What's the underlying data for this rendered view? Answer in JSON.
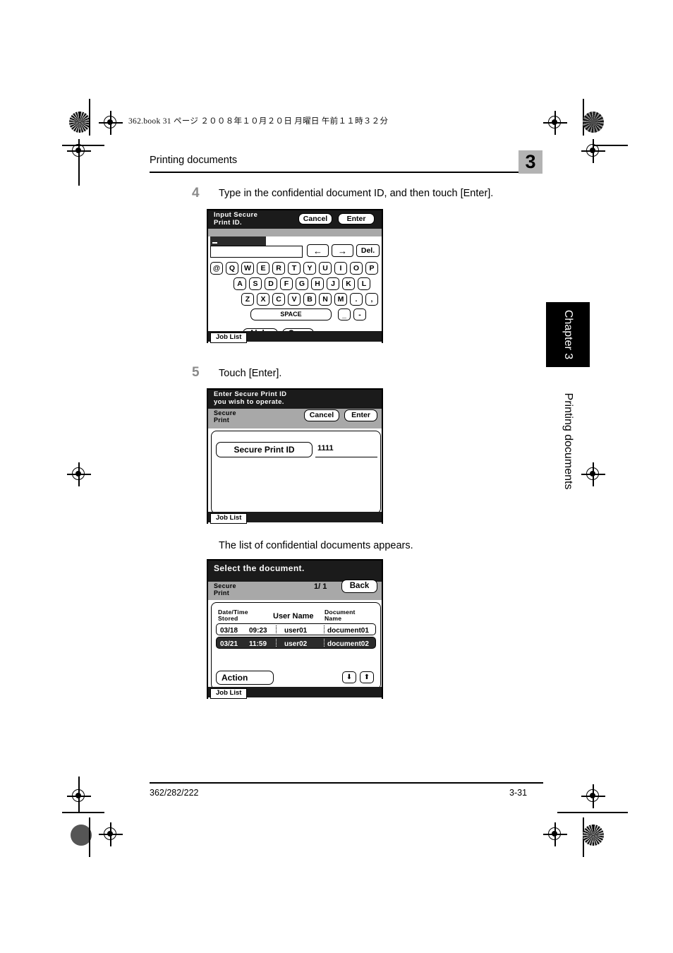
{
  "page": {
    "book_info": "362.book  31 ページ  ２００８年１０月２０日  月曜日  午前１１時３２分",
    "running_head": "Printing documents",
    "chapter_number": "3",
    "side_tab_label": "Chapter 3",
    "side_vertical_label": "Printing documents",
    "footer_left": "362/282/222",
    "footer_right": "3-31"
  },
  "steps": [
    {
      "number": "4",
      "text": "Type in the confidential document ID, and then touch [Enter]."
    },
    {
      "number": "5",
      "text": "Touch [Enter]."
    }
  ],
  "caption": "The list of confidential documents appears.",
  "panel1": {
    "title": "Input Secure\nPrint ID.",
    "title_line1": "Input Secure",
    "title_line2": "Print ID.",
    "cancel_label": "Cancel",
    "enter_label": "Enter",
    "left_arrow": "←",
    "right_arrow": "→",
    "del_label": "Del.",
    "keys_row1": [
      "@",
      "Q",
      "W",
      "E",
      "R",
      "T",
      "Y",
      "U",
      "I",
      "O",
      "P"
    ],
    "keys_row2": [
      "A",
      "S",
      "D",
      "F",
      "G",
      "H",
      "J",
      "K",
      "L"
    ],
    "keys_row3": [
      "Z",
      "X",
      "C",
      "V",
      "B",
      "N",
      "M",
      ".",
      ","
    ],
    "space_label": "SPACE",
    "underscore_label": "_",
    "hyphen_label": "-",
    "alpha_label": "Alpha",
    "caps_label": "Caps",
    "job_list_label": "Job List"
  },
  "panel2": {
    "title_line1": "Enter Secure Print ID",
    "title_line2": "you wish to operate.",
    "sub_line1": "Secure",
    "sub_line2": "Print",
    "cancel_label": "Cancel",
    "enter_label": "Enter",
    "field_label": "Secure Print ID",
    "field_value": "1111",
    "job_list_label": "Job List"
  },
  "panel3": {
    "title": "Select the document.",
    "sub_line1": "Secure",
    "sub_line2": "Print",
    "page_indicator": "1/ 1",
    "back_label": "Back",
    "columns": {
      "datetime_line1": "Date/Time",
      "datetime_line2": "Stored",
      "username": "User Name",
      "docname_line1": "Document",
      "docname_line2": "Name"
    },
    "rows": [
      {
        "date": "03/18",
        "time": "09:23",
        "user": "user01",
        "doc": "document01",
        "selected": false
      },
      {
        "date": "03/21",
        "time": "11:59",
        "user": "user02",
        "doc": "document02",
        "selected": true
      }
    ],
    "action_label": "Action",
    "down_arrow": "⬇",
    "up_arrow": "⬆",
    "job_list_label": "Job List"
  }
}
